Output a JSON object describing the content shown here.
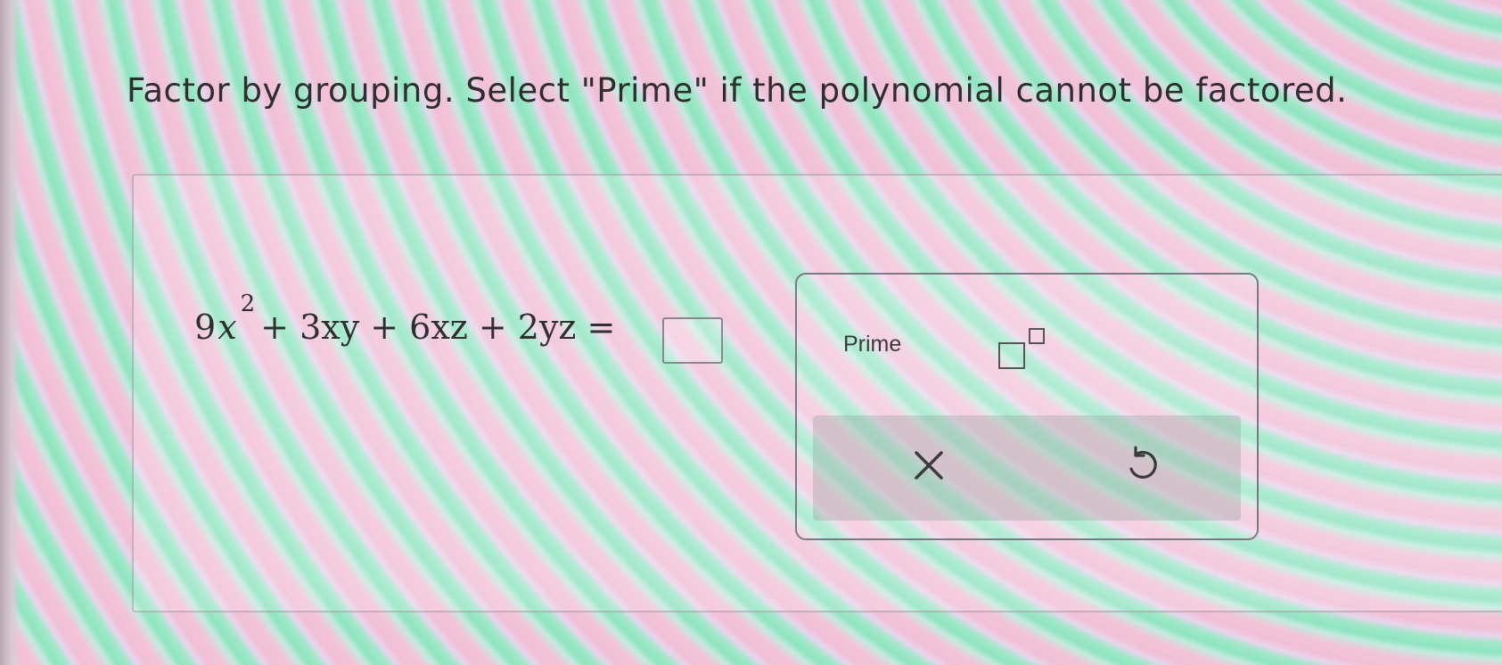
{
  "instruction": "Factor by grouping. Select \"Prime\" if the polynomial cannot be factored.",
  "equation": {
    "coef1": "9",
    "var1": "x",
    "exponent": "2",
    "rest": "+ 3xy + 6xz + 2yz ="
  },
  "answer": {
    "value": ""
  },
  "toolbar": {
    "prime_label": "Prime",
    "exponent_icon": "superscript-template-icon",
    "clear_icon": "x-icon",
    "undo_icon": "undo-icon"
  },
  "colors": {
    "text": "#2e2e2e",
    "border": "#7b7884"
  }
}
